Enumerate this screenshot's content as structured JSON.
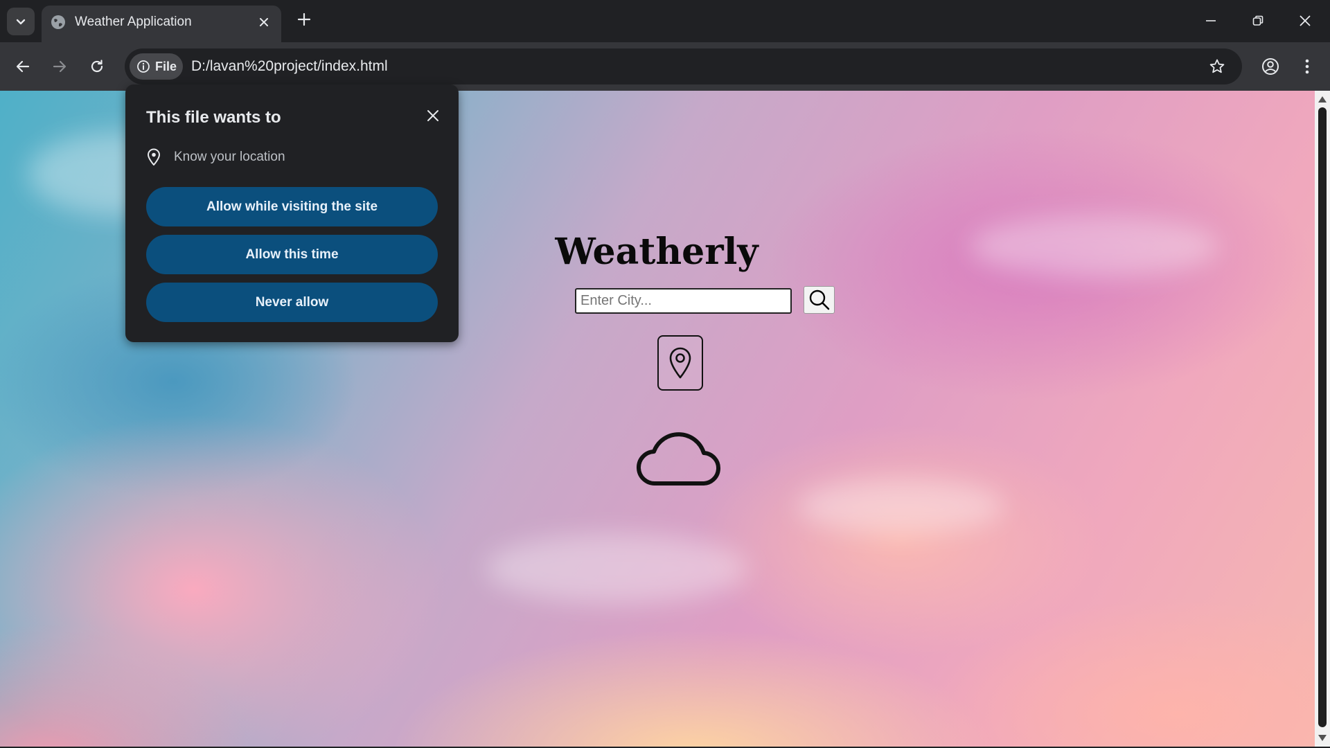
{
  "browser": {
    "tab_title": "Weather Application",
    "url": "D:/lavan%20project/index.html",
    "site_chip_label": "File"
  },
  "permission_popup": {
    "title": "This file wants to",
    "permission_label": "Know your location",
    "allow_visiting_label": "Allow while visiting the site",
    "allow_once_label": "Allow this time",
    "never_allow_label": "Never allow"
  },
  "app": {
    "title": "Weatherly",
    "search_placeholder": "Enter City...",
    "weather_icon": "cloud-icon"
  },
  "colors": {
    "browser_frame": "#202124",
    "toolbar": "#35363a",
    "popup_button": "#0b4f7d"
  }
}
